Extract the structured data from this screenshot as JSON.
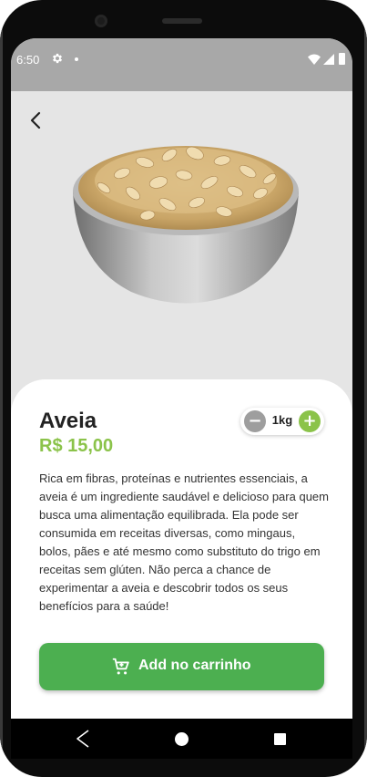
{
  "status_bar": {
    "time": "6:50",
    "icons": [
      "gear-icon",
      "notification-dot",
      "wifi-icon",
      "signal-icon",
      "battery-icon"
    ]
  },
  "header": {
    "back_icon": "chevron-left-icon"
  },
  "product": {
    "name": "Aveia",
    "price": "R$ 15,00",
    "image": "bowl of rolled oats",
    "description": "Rica em fibras, proteínas e nutrientes essenciais, a aveia é um ingrediente saudável e delicioso para quem busca uma alimentação equilibrada. Ela pode ser consumida em receitas diversas, como mingaus, bolos, pães e até mesmo como substituto do trigo em receitas sem glúten. Não perca a chance de experimentar a aveia e descobrir todos os seus benefícios para a saúde!"
  },
  "quantity": {
    "minus_label": "−",
    "value": "1kg",
    "plus_label": "+"
  },
  "add_button": {
    "label": "Add no carrinho",
    "icon": "cart-icon"
  },
  "colors": {
    "accent_green": "#8bc34a",
    "button_green": "#4caf50",
    "status_bar": "#a8a8a8"
  },
  "nav_bar": {
    "icons": [
      "nav-back-icon",
      "nav-home-icon",
      "nav-recents-icon"
    ]
  }
}
